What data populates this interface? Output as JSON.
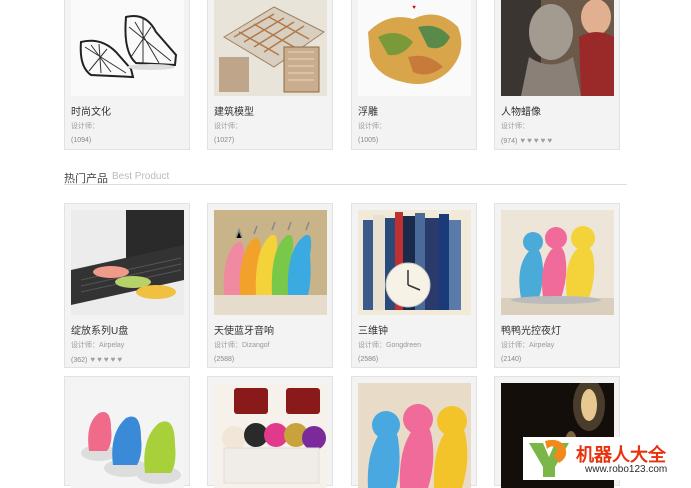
{
  "top_row": [
    {
      "title": "时尚文化",
      "designer": "设计师：",
      "count": "(1094)",
      "hearts": 0,
      "image": "lattice-shoes"
    },
    {
      "title": "建筑模型",
      "designer": "设计师：",
      "count": "(1027)",
      "hearts": 0,
      "image": "architecture-model"
    },
    {
      "title": "浮雕",
      "designer": "设计师：",
      "count": "(1005)",
      "hearts": 0,
      "image": "relief-map"
    },
    {
      "title": "人物蜡像",
      "designer": "设计师：",
      "count": "(974)",
      "hearts": 5,
      "image": "wax-figure"
    }
  ],
  "section": {
    "title": "热门产品",
    "subtitle": "Best Product"
  },
  "hot_products": [
    {
      "title": "绽放系列U盘",
      "designer": "设计师：Airpelay",
      "count": "(362)",
      "hearts": 5,
      "image": "usb-flowers"
    },
    {
      "title": "天使蓝牙音响",
      "designer": "设计师：Dizangof",
      "count": "(2588)",
      "hearts": 0,
      "image": "angel-speakers"
    },
    {
      "title": "三维钟",
      "designer": "设计师：Gongdreen",
      "count": "(2586)",
      "hearts": 0,
      "image": "book-clock"
    },
    {
      "title": "鸭鸭光控夜灯",
      "designer": "设计师：Airpelay",
      "count": "(2140)",
      "hearts": 0,
      "image": "duck-lamp"
    }
  ],
  "bottom_row": [
    {
      "image": "animal-figurines"
    },
    {
      "image": "perfume-bottles"
    },
    {
      "image": "cat-figurines"
    },
    {
      "image": "lamp-dark"
    }
  ],
  "watermark": {
    "text": "机器人大全",
    "url": "www.robo123.com"
  },
  "colors": {
    "accent": "#e8320e",
    "logo_green": "#7ab648",
    "logo_orange": "#f08a1c"
  }
}
